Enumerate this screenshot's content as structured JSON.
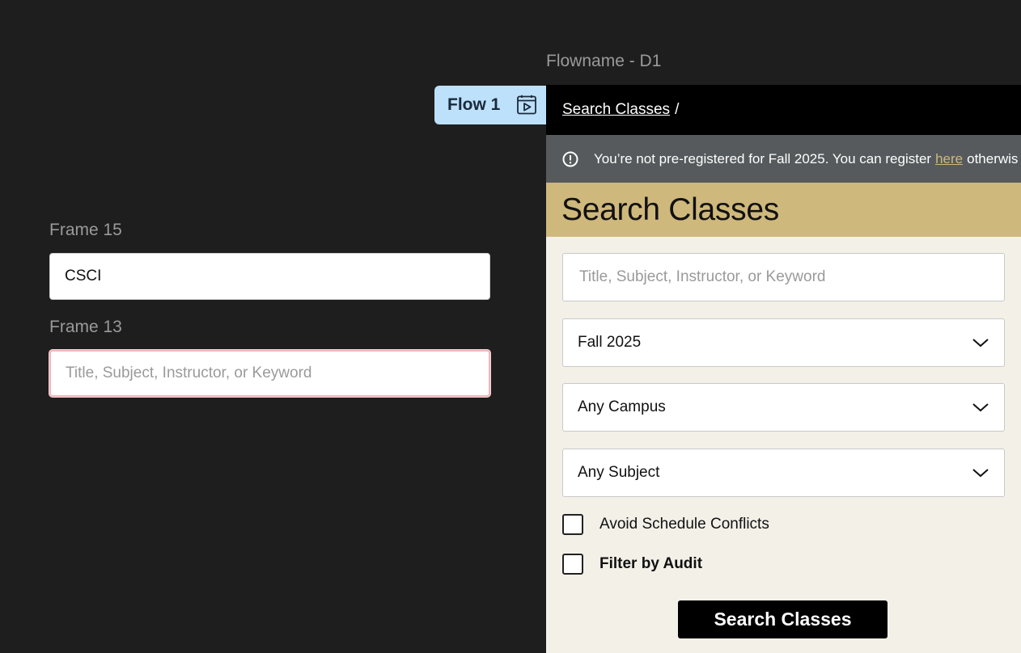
{
  "canvas": {
    "frames": [
      {
        "label": "Frame 15",
        "value": "CSCI"
      },
      {
        "label": "Frame 13",
        "placeholder": "Title, Subject, Instructor, or Keyword"
      }
    ],
    "flow": {
      "tab_label": "Flow 1",
      "title": "Flowname - D1"
    }
  },
  "app": {
    "breadcrumb": {
      "link": "Search Classes",
      "separator": "/"
    },
    "notice": {
      "text_before": "You’re not pre-registered for Fall 2025. You can register",
      "link": "here",
      "text_after": "otherwis"
    },
    "heading": "Search Classes",
    "search": {
      "placeholder": "Title, Subject, Instructor, or Keyword"
    },
    "selects": {
      "term": "Fall 2025",
      "campus": "Any Campus",
      "subject": "Any Subject"
    },
    "checkboxes": {
      "avoid_conflicts": "Avoid Schedule Conflicts",
      "filter_audit": "Filter by Audit"
    },
    "submit_label": "Search Classes"
  },
  "colors": {
    "canvas_bg": "#1e1e1e",
    "flow_tab": "#bde0fb",
    "gold": "#cfb87c",
    "notice_bg": "#565a5c",
    "page_bg": "#f3f0e8",
    "error_border": "#f2b6bb"
  }
}
